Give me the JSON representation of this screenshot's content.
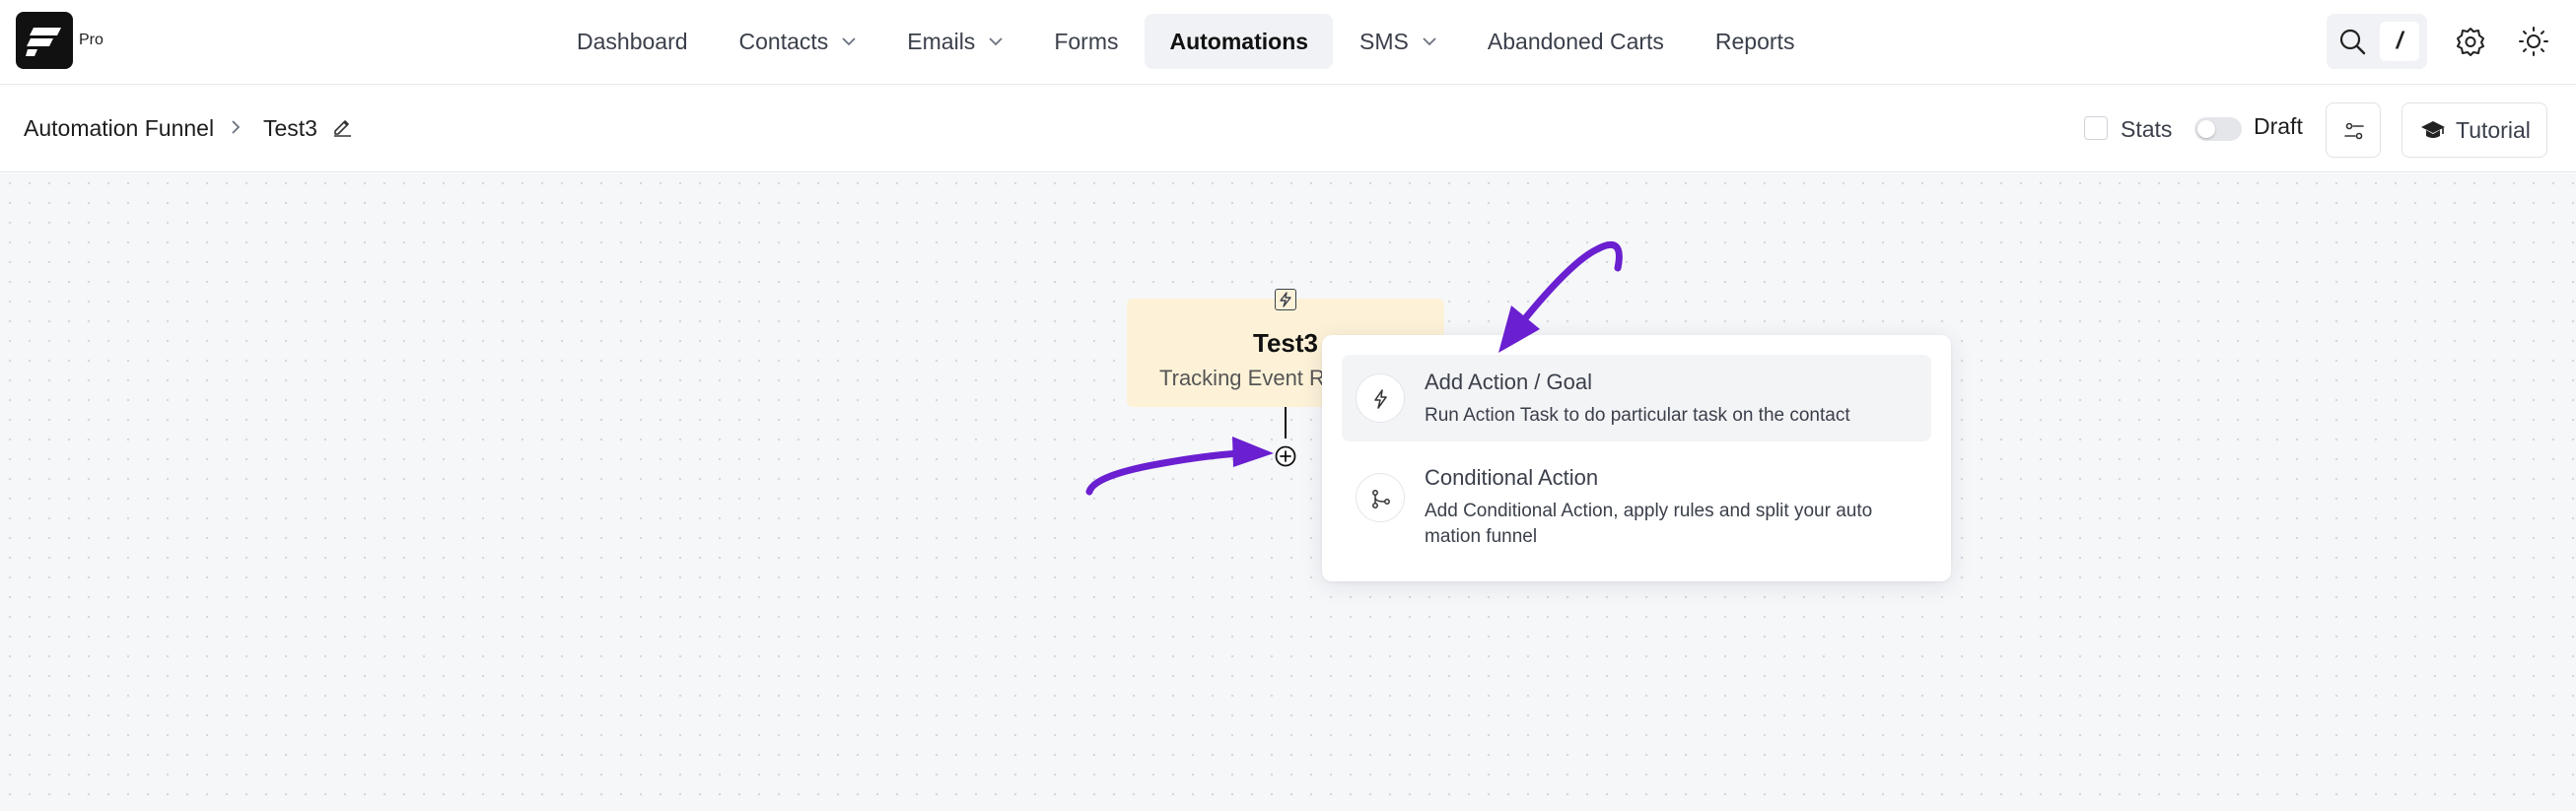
{
  "header": {
    "brand_badge": "Pro",
    "nav": [
      {
        "label": "Dashboard",
        "dropdown": false,
        "active": false
      },
      {
        "label": "Contacts",
        "dropdown": true,
        "active": false
      },
      {
        "label": "Emails",
        "dropdown": true,
        "active": false
      },
      {
        "label": "Forms",
        "dropdown": false,
        "active": false
      },
      {
        "label": "Automations",
        "dropdown": false,
        "active": true
      },
      {
        "label": "SMS",
        "dropdown": true,
        "active": false
      },
      {
        "label": "Abandoned Carts",
        "dropdown": false,
        "active": false
      },
      {
        "label": "Reports",
        "dropdown": false,
        "active": false
      }
    ],
    "search_shortcut": "/"
  },
  "subheader": {
    "breadcrumb_root": "Automation Funnel",
    "breadcrumb_current": "Test3",
    "stats_label": "Stats",
    "stats_checked": false,
    "draft_label": "Draft",
    "draft_on": false,
    "tutorial_label": "Tutorial"
  },
  "canvas": {
    "trigger": {
      "title": "Test3",
      "subtitle": "Tracking Event R"
    },
    "menu": [
      {
        "title": "Add Action / Goal",
        "description": "Run Action Task to do particular task on the contact",
        "icon": "bolt-icon"
      },
      {
        "title": "Conditional Action",
        "description": "Add Conditional Action, apply rules and split your auto mation funnel",
        "icon": "branch-icon"
      }
    ]
  },
  "colors": {
    "accent_arrow": "#6a1fd0",
    "trigger_bg": "#fdf2d8",
    "canvas_bg": "#f6f7f9"
  }
}
